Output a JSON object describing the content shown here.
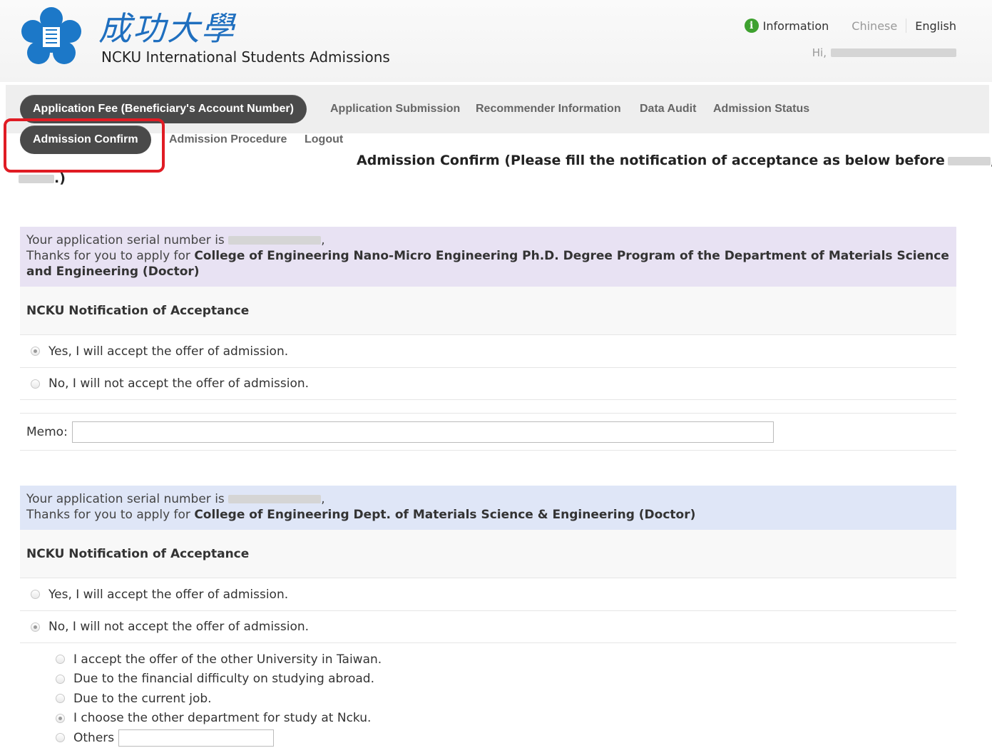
{
  "header": {
    "logo_script": "成功大學",
    "site_title": "NCKU International Students Admissions",
    "information_label": "Information",
    "lang_chinese": "Chinese",
    "lang_english": "English",
    "greeting": "Hi,"
  },
  "nav": {
    "items": [
      {
        "label": "Application Fee (Beneficiary's Account Number)",
        "active": true
      },
      {
        "label": "Application Submission"
      },
      {
        "label": "Recommender Information"
      },
      {
        "label": "Data Audit"
      },
      {
        "label": "Admission Status"
      },
      {
        "label": "Admission Confirm",
        "active": true,
        "highlighted": true
      },
      {
        "label": "Admission Procedure"
      },
      {
        "label": "Logout"
      }
    ]
  },
  "page": {
    "heading": "Admission Confirm (Please fill the notification of acceptance as below before",
    "heading_tail": ".)",
    "highlight_color": "#e01c24"
  },
  "applications": [
    {
      "serial_prefix": "Your application serial number is",
      "thanks_prefix": "Thanks for you to apply for",
      "program": "College of Engineering Nano-Micro Engineering Ph.D. Degree Program of the Department of Materials Science and Engineering (Doctor)",
      "header_bg": "#e8e2f3",
      "section_title": "NCKU Notification of Acceptance",
      "option_yes": "Yes, I will accept the offer of admission.",
      "option_no": "No, I will not accept the offer of admission.",
      "selected": "yes",
      "memo_label": "Memo:"
    },
    {
      "serial_prefix": "Your application serial number is",
      "thanks_prefix": "Thanks for you to apply for",
      "program": "College of Engineering Dept. of Materials Science & Engineering (Doctor)",
      "header_bg": "#dfe6f7",
      "section_title": "NCKU Notification of Acceptance",
      "option_yes": "Yes, I will accept the offer of admission.",
      "option_no": "No, I will not accept the offer of admission.",
      "selected": "no",
      "reasons": [
        {
          "label": "I accept the offer of the other University in Taiwan.",
          "selected": false
        },
        {
          "label": "Due to the financial difficulty on studying abroad.",
          "selected": false
        },
        {
          "label": "Due to the current job.",
          "selected": false
        },
        {
          "label": "I choose the other department for study at Ncku.",
          "selected": true
        },
        {
          "label": "Others",
          "selected": false
        }
      ]
    }
  ]
}
